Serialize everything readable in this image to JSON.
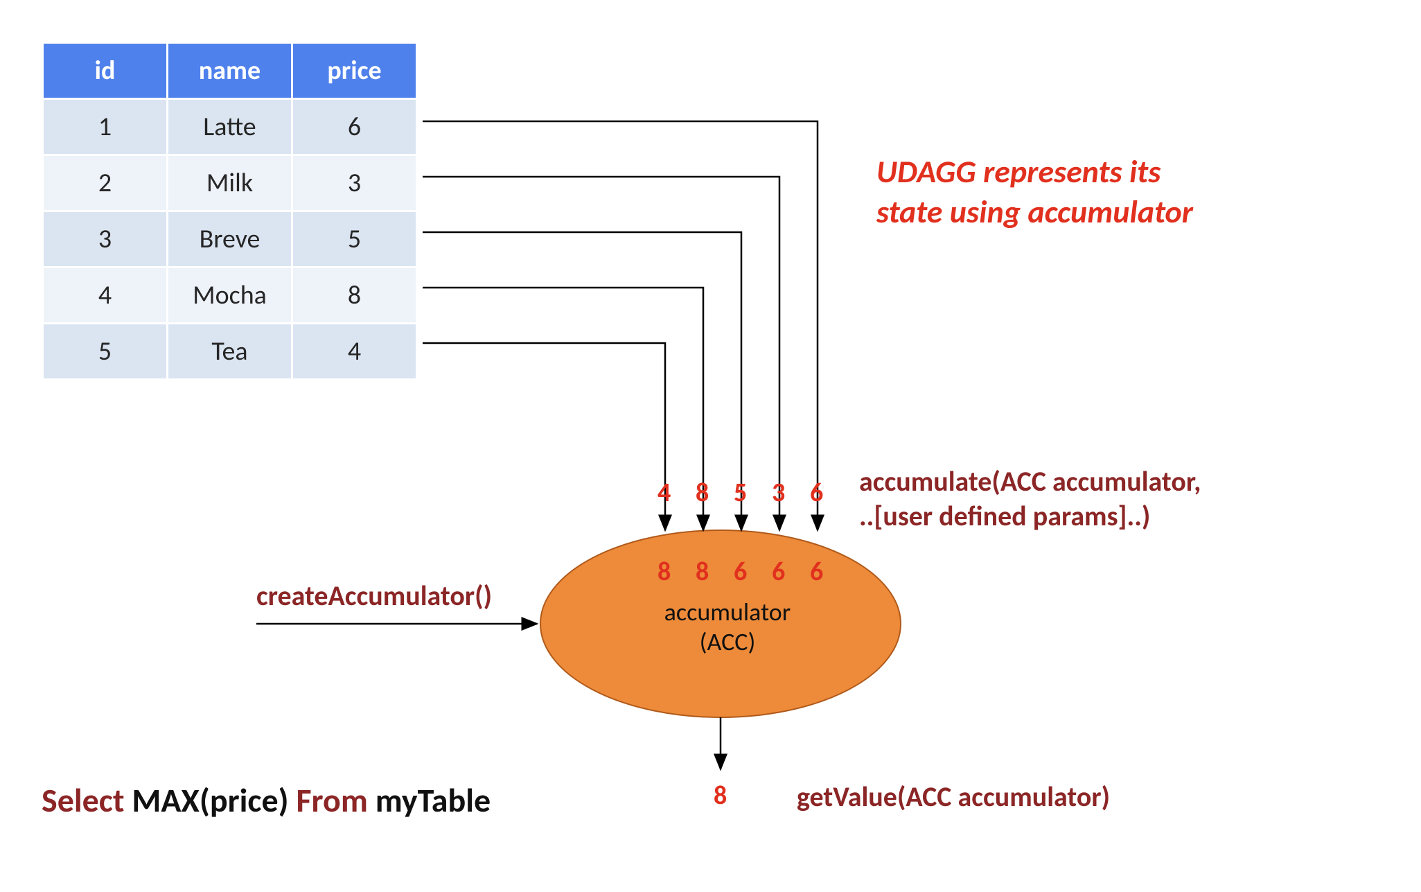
{
  "table": {
    "headers": [
      "id",
      "name",
      "price"
    ],
    "rows": [
      {
        "id": "1",
        "name": "Latte",
        "price": "6"
      },
      {
        "id": "2",
        "name": "Milk",
        "price": "3"
      },
      {
        "id": "3",
        "name": "Breve",
        "price": "5"
      },
      {
        "id": "4",
        "name": "Mocha",
        "price": "8"
      },
      {
        "id": "5",
        "name": "Tea",
        "price": "4"
      }
    ]
  },
  "udagg_note_line1": "UDAGG represents its",
  "udagg_note_line2": "state using accumulator",
  "createAccumulator_label": "createAccumulator()",
  "accumulate_label_line1": "accumulate(ACC accumulator,",
  "accumulate_label_line2": "..[user defined params]..)",
  "getValue_label": "getValue(ACC accumulator)",
  "accumulator_line1": "accumulator",
  "accumulator_line2": "(ACC)",
  "input_numbers": [
    "4",
    "8",
    "5",
    "3",
    "6"
  ],
  "state_numbers": [
    "8",
    "8",
    "6",
    "6",
    "6"
  ],
  "result_number": "8",
  "sql": {
    "select": "Select",
    "fn": "MAX(price)",
    "from": "From",
    "tbl": "myTable"
  }
}
